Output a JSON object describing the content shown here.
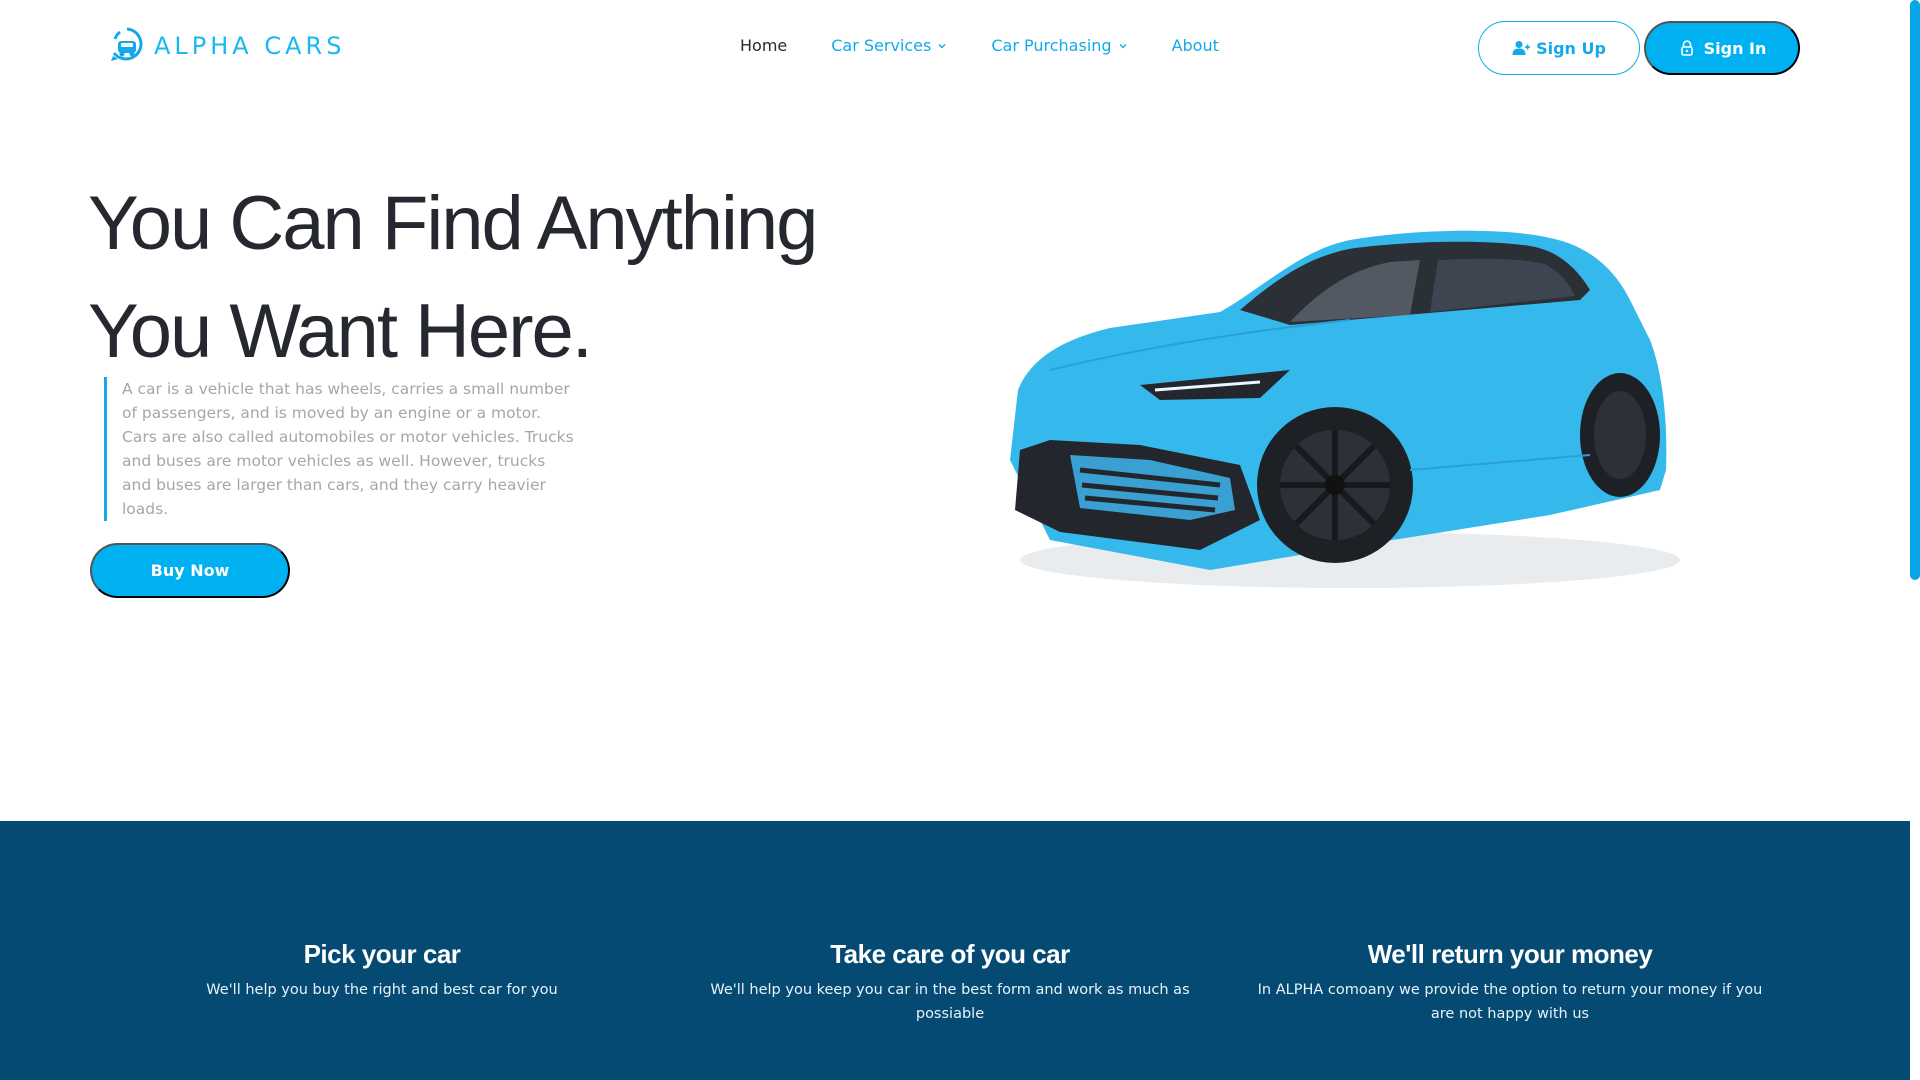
{
  "brand": {
    "name": "ALPHA CARS",
    "logo_icon": "car-badge-icon",
    "accent": "#14a9e8"
  },
  "nav": {
    "items": [
      {
        "label": "Home",
        "active": true,
        "dropdown": false
      },
      {
        "label": "Car Services",
        "active": false,
        "dropdown": true
      },
      {
        "label": "Car Purchasing",
        "active": false,
        "dropdown": true
      },
      {
        "label": "About",
        "active": false,
        "dropdown": false
      }
    ],
    "signup_label": "Sign Up",
    "signup_icon": "user-plus-icon",
    "signin_label": "Sign In",
    "signin_icon": "lock-icon"
  },
  "hero": {
    "title_line1": "You Can Find Anything",
    "title_line2": "You Want Here.",
    "description": "A car is a vehicle that has wheels, carries a small number of passengers, and is moved by an engine or a motor. Cars are also called automobiles or motor vehicles. Trucks and buses are motor vehicles as well. However, trucks and buses are larger than cars, and they carry heavier loads.",
    "cta_label": "Buy Now",
    "car_color": "#35b9ec"
  },
  "features": [
    {
      "title": "Pick your car",
      "text": "We'll help you buy the right and best car for you"
    },
    {
      "title": "Take care of you car",
      "text": "We'll help you keep you car in the best form and work as much as possiable"
    },
    {
      "title": "We'll return your money",
      "text": "In ALPHA comoany we provide the option to return your money if you are not happy with us"
    }
  ],
  "colors": {
    "primary": "#00b1f2",
    "dark_band": "#054a73",
    "heading": "#25282e",
    "muted": "#a3a7ad"
  }
}
